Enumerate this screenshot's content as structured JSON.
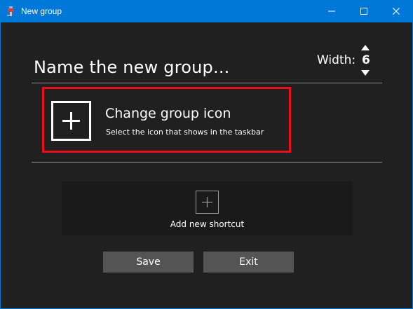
{
  "window": {
    "title": "New group",
    "accent_color": "#0078d7",
    "icons": {
      "app": "taskbar-groups-app-icon",
      "minimize": "minimize-icon",
      "maximize": "maximize-icon",
      "close": "close-icon"
    }
  },
  "header": {
    "group_name_placeholder": "Name the new group...",
    "width_label": "Width:",
    "width_value": "6"
  },
  "group_icon": {
    "title": "Change group icon",
    "subtitle": "Select the icon that shows in the taskbar",
    "highlight_color": "#e8111b",
    "icon": "plus-icon"
  },
  "shortcuts": {
    "add_label": "Add new shortcut",
    "icon": "plus-icon"
  },
  "actions": {
    "save_label": "Save",
    "exit_label": "Exit"
  }
}
